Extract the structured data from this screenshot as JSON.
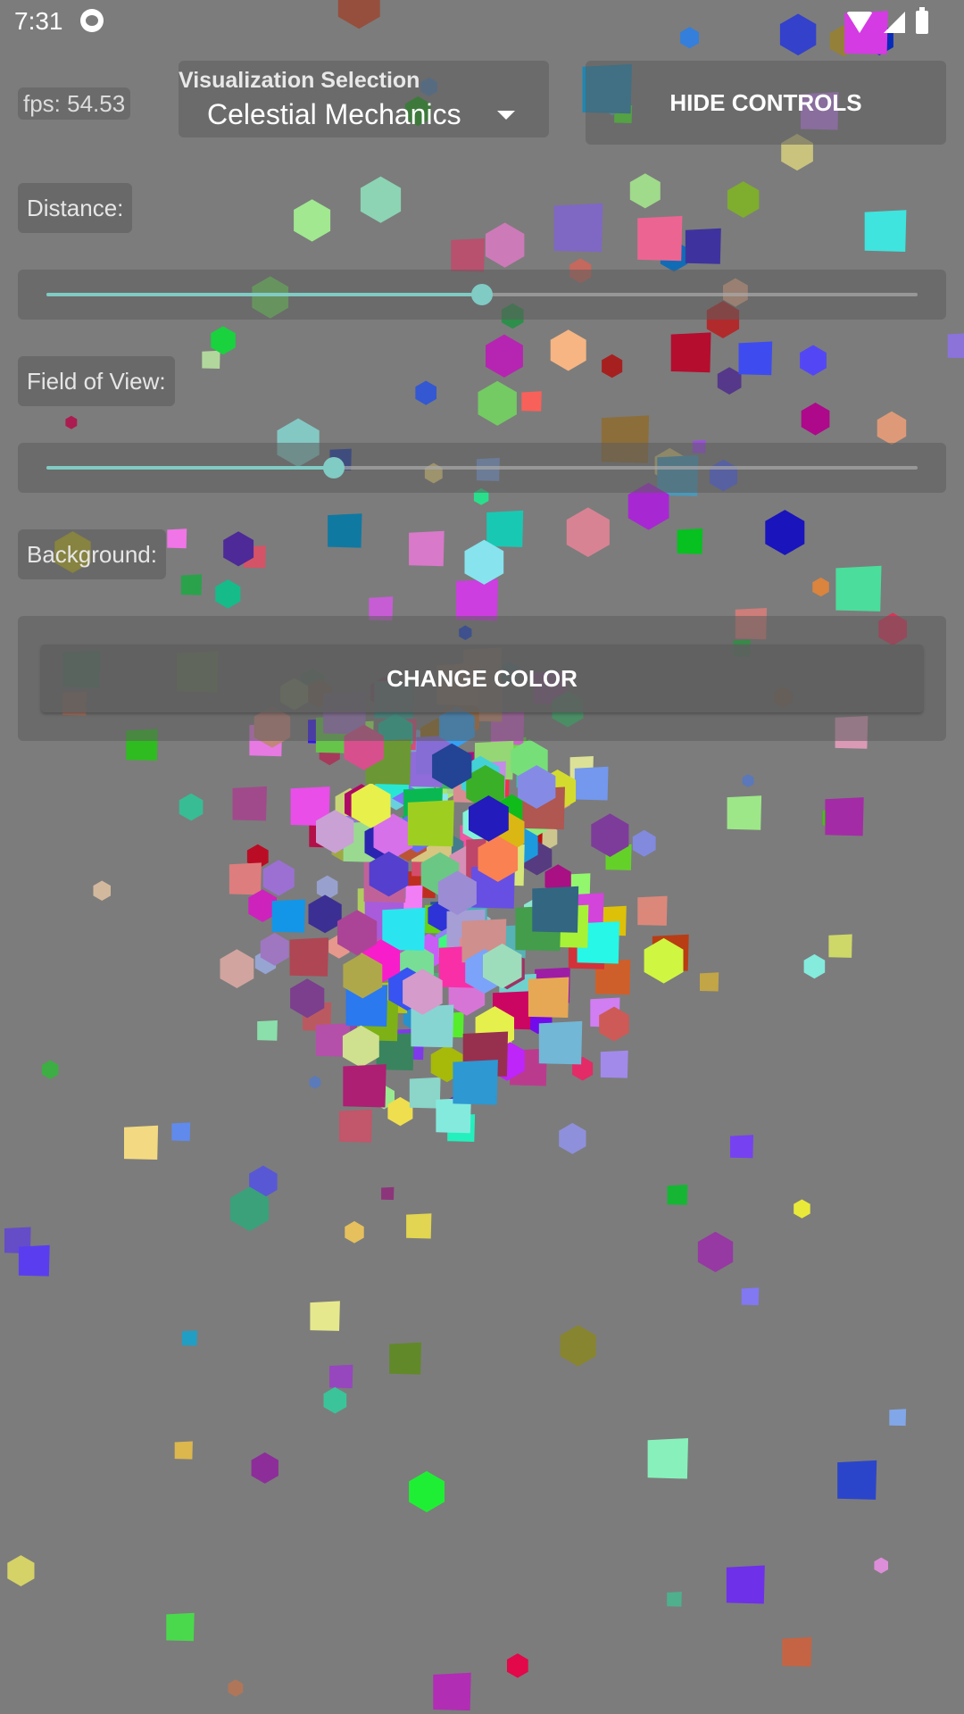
{
  "status_bar": {
    "time": "7:31"
  },
  "fps_label": "fps: 54.53",
  "visualization": {
    "title": "Visualization Selection",
    "selected": "Celestial Mechanics"
  },
  "hide_controls_label": "HIDE CONTROLS",
  "distance": {
    "label": "Distance:",
    "value_fraction": 0.5
  },
  "field_of_view": {
    "label": "Field of View:",
    "value_fraction": 0.33
  },
  "background": {
    "label": "Background:",
    "button_label": "CHANGE COLOR"
  },
  "scene": {
    "background_color": "#7c7c7c",
    "cube_count": 360,
    "seed": 31
  }
}
